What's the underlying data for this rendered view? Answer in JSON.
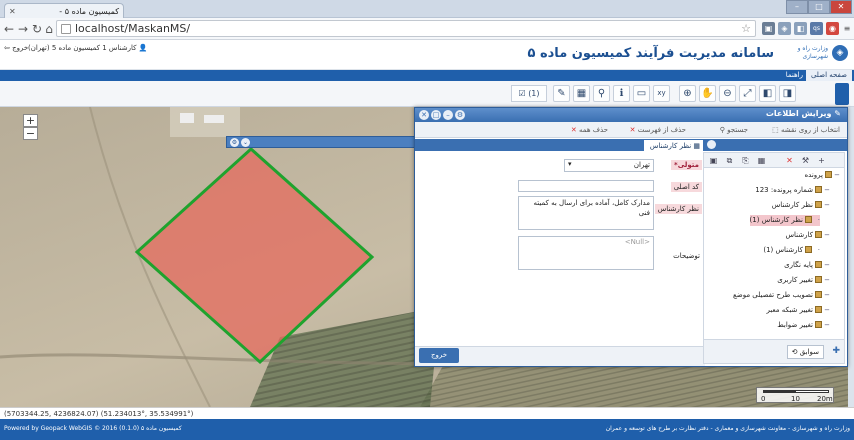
{
  "browser": {
    "tab_title": "کمیسیون ماده ۵ -",
    "url": "localhost/MaskanMS/"
  },
  "app": {
    "title": "سامانه مدیریت فرآیند کمیسیون ماده ۵",
    "logo_text": "وزارت راه و شهرسازی",
    "user_info": "کارشناس 1 کمیسیون ماده 5 (تهران)",
    "exit_label": "خروج"
  },
  "nav": {
    "tab_home": "صفحه اصلی",
    "tab_guide": "راهنما"
  },
  "toolbar": {
    "count_badge": "(1)"
  },
  "map": {
    "zoom_in": "+",
    "zoom_out": "−",
    "scale_zero": "0",
    "scale_mid": "10",
    "scale_end": "20m",
    "parcel_fill": "#e46b5e",
    "parcel_stroke": "#1fa32e"
  },
  "coords": "(5703344.25, 4236824.07) (51.234013°, 35.534991°)",
  "footer": {
    "left": "Powered by  Geopack WebGIS  © 2016 (0.1.0) کمیسیون ماده ۵",
    "right": "وزارت راه و شهرسازی - معاونت شهرسازی و معماری - دفتر نظارت بر طرح های توسعه و عمران"
  },
  "dialog": {
    "title": "ویرایش اطلاعات",
    "tools": {
      "select_on_map": "انتخاب از روی نقشه",
      "search": "جستجو",
      "remove_from_list": "حذف از فهرست",
      "remove_all": "حذف همه"
    },
    "form_tab": "نظر کارشناس",
    "form": {
      "from_label": "متولی*",
      "from_value": "تهران",
      "main_code_label": "کد اصلی",
      "main_code_value": "",
      "expert_opinion_label": "نظر کارشناس",
      "expert_opinion_value": "مدارک کامل، آماده برای ارسال به کمیته فنی",
      "desc_label": "توضیحات",
      "desc_placeholder": "<Null>"
    },
    "exit_button": "خروج",
    "history_button": "سوابق"
  },
  "tree": {
    "nodes": [
      {
        "label": "پرونده",
        "level": 0,
        "selected": false
      },
      {
        "label": "شماره پرونده: 123",
        "level": 1,
        "selected": false
      },
      {
        "label": "نظر کارشناس",
        "level": 1,
        "selected": false
      },
      {
        "label": "نظر کارشناس (1)",
        "level": 2,
        "selected": true
      },
      {
        "label": "کارشناس",
        "level": 1,
        "selected": false
      },
      {
        "label": "کارشناس (1)",
        "level": 2,
        "selected": false
      },
      {
        "label": "پایه نگاری",
        "level": 1,
        "selected": false
      },
      {
        "label": "تغییر کاربری",
        "level": 1,
        "selected": false
      },
      {
        "label": "تصویب طرح تفصیلی موضع",
        "level": 1,
        "selected": false
      },
      {
        "label": "تغییر شبکه معبر",
        "level": 1,
        "selected": false
      },
      {
        "label": "تغییر ضوابط",
        "level": 1,
        "selected": false
      }
    ]
  }
}
